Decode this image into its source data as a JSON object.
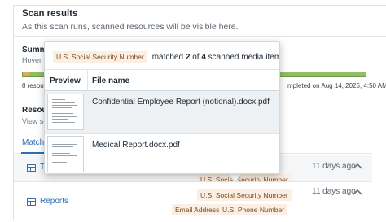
{
  "scan": {
    "title": "Scan results",
    "description": "As this scan runs, scanned resources will be visible here."
  },
  "summary": {
    "title": "Summa",
    "hint": "Hover ov",
    "progress_fraction": 0.02,
    "left_label": "8 resourc",
    "right_label": "mpleted on Aug 14, 2025, 4:50 AM",
    "colors": {
      "pending": "#e6a85b",
      "done": "#8fbe63"
    }
  },
  "resources": {
    "title": "Resour",
    "hint": "View sca",
    "tab_matched": "Matche",
    "rows": [
      {
        "name": "T",
        "time": "11 days ago",
        "tags": [
          "U.S. Social Security Number"
        ]
      },
      {
        "name": "Reports",
        "time": "11 days ago",
        "tags": [
          "U.S. Social Security Number",
          "Email Address",
          "U.S. Phone Number"
        ]
      }
    ]
  },
  "popover": {
    "tag": "U.S. Social Security Number",
    "text_prefix": "matched",
    "matched_count": "2",
    "text_middle": "of",
    "total_count": "4",
    "text_suffix": "scanned media items.",
    "header_preview": "Preview",
    "header_file": "File name",
    "files": [
      {
        "name": "Confidential Employee Report (notional).docx.pdf"
      },
      {
        "name": "Medical Report.docx.pdf"
      }
    ]
  }
}
